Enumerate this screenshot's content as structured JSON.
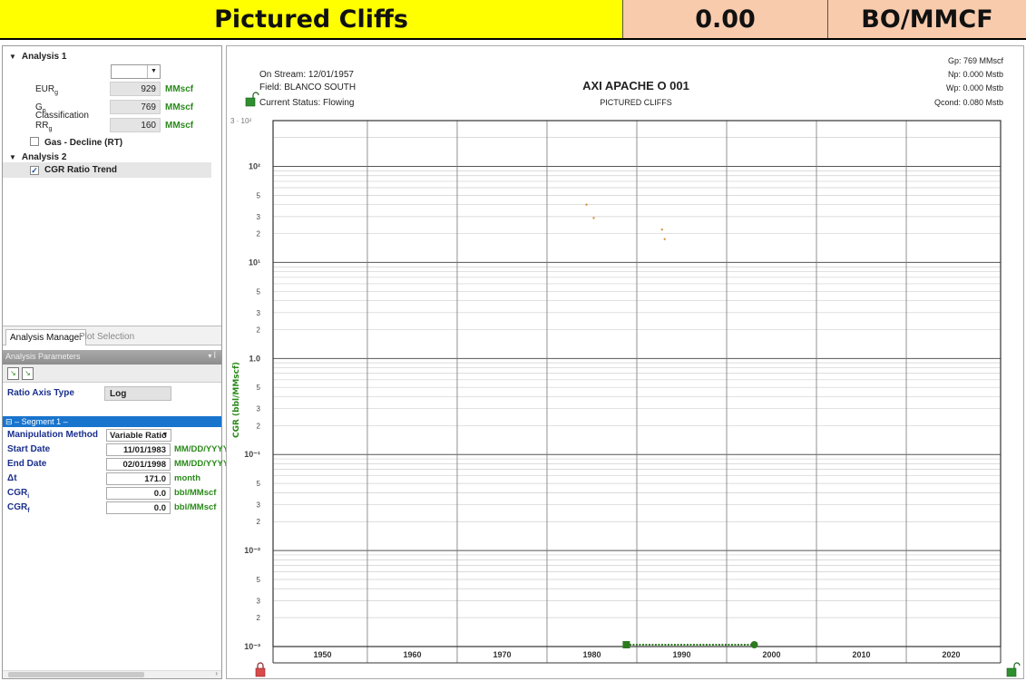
{
  "banner": {
    "formation": "Pictured Cliffs",
    "value": "0.00",
    "unit": "BO/MMCF"
  },
  "analysis_manager": {
    "analysis1": {
      "title": "Analysis 1",
      "classification_label": "Classification",
      "classification_value": "",
      "eur": {
        "label": "EUR",
        "sub": "g",
        "value": "929",
        "unit": "MMscf"
      },
      "gp": {
        "label": "G",
        "sub": "p",
        "value": "769",
        "unit": "MMscf"
      },
      "rr": {
        "label": "RR",
        "sub": "g",
        "value": "160",
        "unit": "MMscf"
      },
      "decline_item": "Gas - Decline (RT)"
    },
    "analysis2": {
      "title": "Analysis 2",
      "item": "CGR Ratio Trend"
    }
  },
  "tabs": {
    "active": "Analysis Manager",
    "inactive": "Plot Selection"
  },
  "params": {
    "header": "Analysis Parameters",
    "ratio_axis_label": "Ratio Axis Type",
    "ratio_axis_value": "Log",
    "segment_title": "– Segment 1 –",
    "rows": {
      "method": {
        "label": "Manipulation Method",
        "value": "Variable Ratio"
      },
      "start": {
        "label": "Start Date",
        "value": "11/01/1983",
        "unit": "MM/DD/YYYY"
      },
      "end": {
        "label": "End Date",
        "value": "02/01/1998",
        "unit": "MM/DD/YYYY"
      },
      "dt": {
        "label": "Δt",
        "value": "171.0",
        "unit": "month"
      },
      "cgri": {
        "label": "CGR",
        "sub": "i",
        "value": "0.0",
        "unit": "bbl/MMscf"
      },
      "cgrf": {
        "label": "CGR",
        "sub": "f",
        "value": "0.0",
        "unit": "bbl/MMscf"
      }
    }
  },
  "plot_header": {
    "on_stream": "On Stream: 12/01/1957",
    "field": "Field: BLANCO SOUTH",
    "status": "Current Status: Flowing",
    "well": "AXI APACHE O 001",
    "formation": "PICTURED CLIFFS",
    "gp": "Gp: 769 MMscf",
    "np": "Np: 0.000 Mstb",
    "wp": "Wp: 0.000 Mstb",
    "qcond": "Qcond: 0.080 Mstb"
  },
  "colors": {
    "accent_green": "#2a8a1a",
    "marker_orange": "#d58a2a",
    "trend_green": "#2d7a1f",
    "segment_blue": "#1874cd"
  },
  "chart_data": {
    "type": "scatter",
    "ylabel": "CGR (bbl/MMscf)",
    "yscale": "log",
    "ylim": [
      0.001,
      300
    ],
    "xlim": [
      1944.5,
      2025.5
    ],
    "xticks": [
      "1950",
      "1960",
      "1970",
      "1980",
      "1990",
      "2000",
      "2010",
      "2020"
    ],
    "yticks": [
      {
        "v": 300,
        "label": "3 · 10²"
      },
      {
        "v": 100,
        "label": "10²"
      },
      {
        "v": 50,
        "label": "5"
      },
      {
        "v": 30,
        "label": "3"
      },
      {
        "v": 20,
        "label": "2"
      },
      {
        "v": 10,
        "label": "10¹"
      },
      {
        "v": 5,
        "label": "5"
      },
      {
        "v": 3,
        "label": "3"
      },
      {
        "v": 2,
        "label": "2"
      },
      {
        "v": 1,
        "label": "1.0"
      },
      {
        "v": 0.5,
        "label": "5"
      },
      {
        "v": 0.3,
        "label": "3"
      },
      {
        "v": 0.2,
        "label": "2"
      },
      {
        "v": 0.1,
        "label": "10⁻¹"
      },
      {
        "v": 0.05,
        "label": "5"
      },
      {
        "v": 0.03,
        "label": "3"
      },
      {
        "v": 0.02,
        "label": "2"
      },
      {
        "v": 0.01,
        "label": "10⁻²"
      },
      {
        "v": 0.005,
        "label": "5"
      },
      {
        "v": 0.003,
        "label": "3"
      },
      {
        "v": 0.002,
        "label": "2"
      },
      {
        "v": 0.001,
        "label": "10⁻³"
      }
    ],
    "grid": true,
    "series": [
      {
        "points": [
          [
            1979.4,
            40
          ],
          [
            1980.2,
            29
          ],
          [
            1987.8,
            22
          ],
          [
            1988.1,
            17.5
          ]
        ]
      }
    ],
    "trend": {
      "x_start": 1983.83,
      "x_end": 1998.08,
      "y": 0.001
    }
  }
}
